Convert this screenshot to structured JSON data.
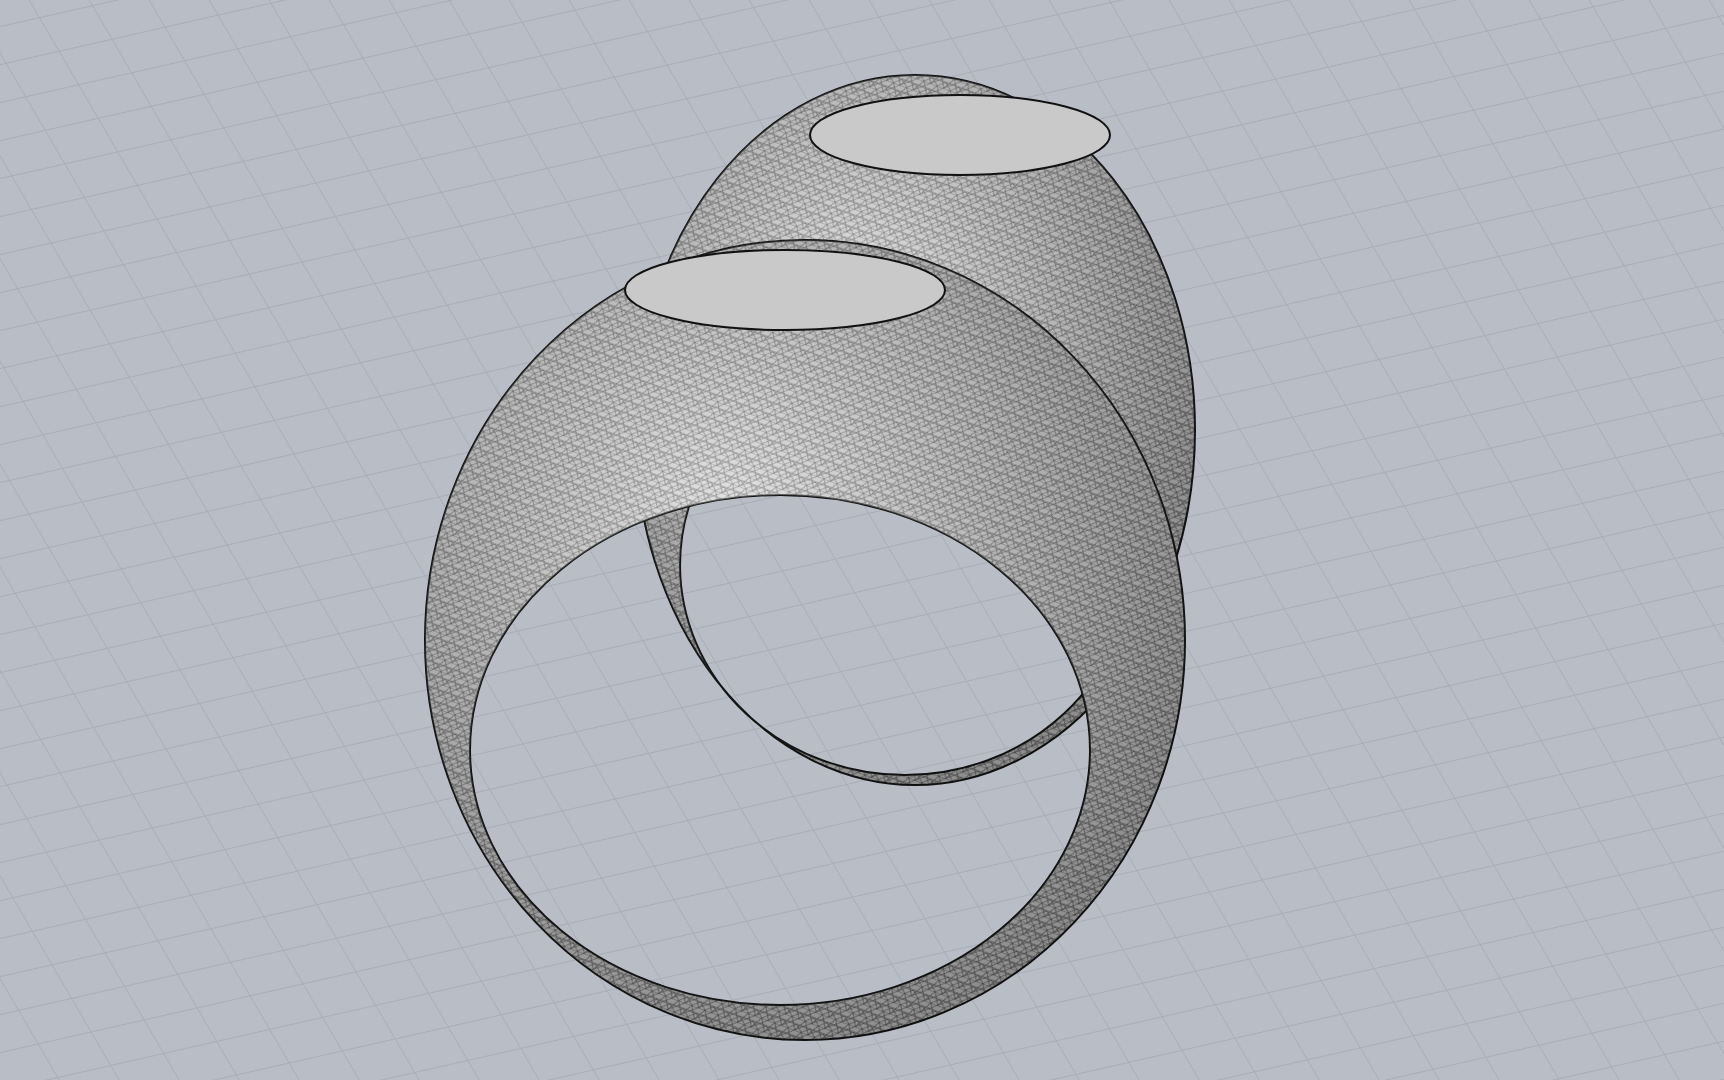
{
  "viewport": {
    "objects": [
      {
        "kind": "ring"
      },
      {
        "kind": "ring"
      }
    ]
  }
}
